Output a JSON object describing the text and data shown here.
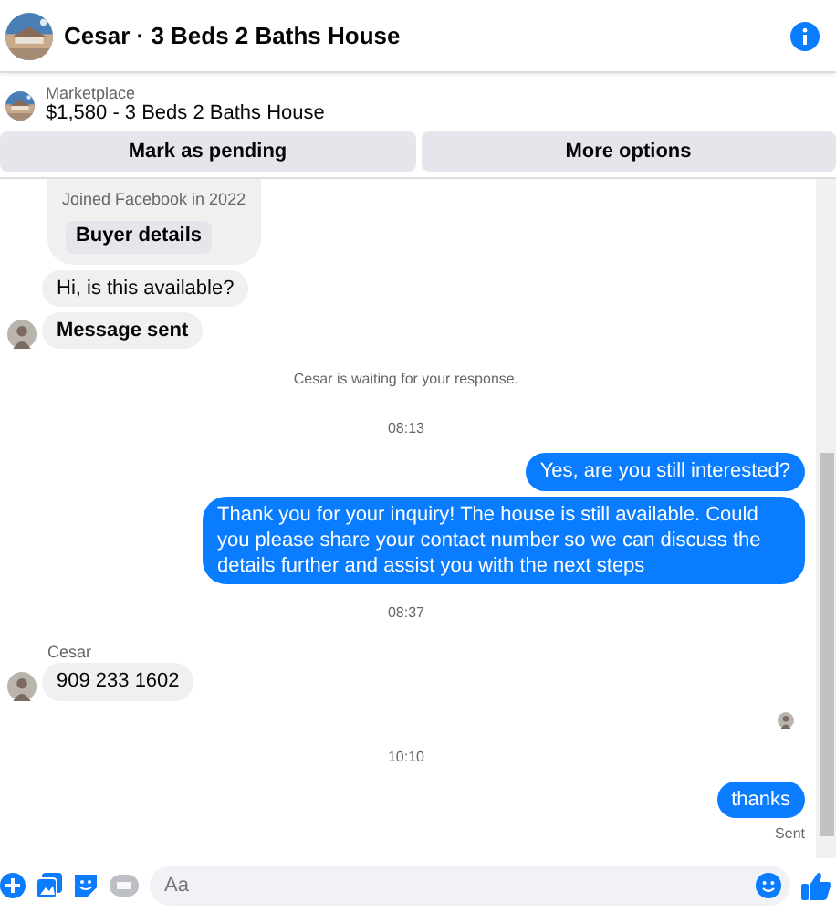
{
  "header": {
    "title": "Cesar · 3 Beds 2 Baths House"
  },
  "listing": {
    "source": "Marketplace",
    "summary": "$1,580 - 3 Beds 2 Baths House"
  },
  "actions": [
    "Mark as pending",
    "More options"
  ],
  "messages": [
    {
      "kind": "card",
      "text": "Joined Facebook in 2022",
      "button": "Buyer details"
    },
    {
      "kind": "incoming",
      "text": "Hi, is this available?",
      "avatar": false,
      "bold": false
    },
    {
      "kind": "incoming",
      "text": "Message sent",
      "avatar": true,
      "bold": true
    },
    {
      "kind": "status",
      "text": "Cesar is waiting for your response."
    },
    {
      "kind": "time",
      "text": "08:13"
    },
    {
      "kind": "outgoing",
      "text": "Yes, are you still interested?"
    },
    {
      "kind": "outgoing",
      "text": "Thank you for your inquiry! The house is still available. Could you please share your contact number so we can discuss the details further and assist you with the next steps"
    },
    {
      "kind": "time",
      "text": "08:37"
    },
    {
      "kind": "sender",
      "text": "Cesar"
    },
    {
      "kind": "incoming",
      "text": "909 233 1602",
      "avatar": true,
      "bold": false
    },
    {
      "kind": "seen"
    },
    {
      "kind": "time",
      "text": "10:10"
    },
    {
      "kind": "outgoing",
      "text": "thanks"
    },
    {
      "kind": "delivery",
      "text": "Sent"
    }
  ],
  "composer": {
    "placeholder": "Aa"
  }
}
